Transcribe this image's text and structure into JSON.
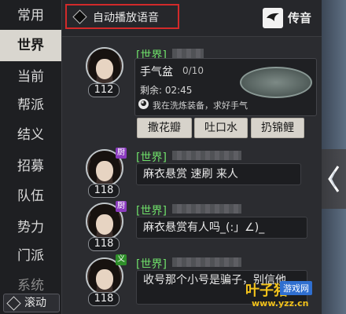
{
  "sidebar": {
    "items": [
      {
        "label": "常用",
        "active": false
      },
      {
        "label": "世界",
        "active": true
      },
      {
        "label": "当前",
        "active": false
      },
      {
        "label": "帮派",
        "active": false
      },
      {
        "label": "结义",
        "active": false
      },
      {
        "label": "招募",
        "active": false
      },
      {
        "label": "队伍",
        "active": false
      },
      {
        "label": "势力",
        "active": false
      },
      {
        "label": "门派",
        "active": false
      },
      {
        "label": "系统",
        "active": false
      }
    ],
    "scroll_label": "滚动"
  },
  "header": {
    "auto_play_label": "自动播放语音",
    "transmit_label": "传音"
  },
  "messages": [
    {
      "channel": "[世界]",
      "level": "112",
      "task": {
        "title": "手气盆",
        "count": "0/10",
        "remain": "剩余: 02:45",
        "wish": "我在洗炼装备，求好手气"
      },
      "actions": [
        "撒花瓣",
        "吐口水",
        "扔锦鲤"
      ]
    },
    {
      "channel": "[世界]",
      "level": "118",
      "badge": "厨",
      "text": "麻衣悬赏  速刷 来人"
    },
    {
      "channel": "[世界]",
      "level": "118",
      "badge": "厨",
      "text": "麻衣悬赏有人吗_(:」∠)_"
    },
    {
      "channel": "[世界]",
      "level": "118",
      "badge": "义",
      "text": "收号那个小号是骗子，别信他"
    }
  ],
  "watermark": {
    "brand": "叶子猪",
    "tag": "游戏网",
    "url": "www.yzz.cn"
  },
  "colors": {
    "channel_green": "#6fe06a",
    "highlight_red": "#d22a2a",
    "chef_purple": "#8b3bbf",
    "yi_green": "#2f8f2a"
  }
}
